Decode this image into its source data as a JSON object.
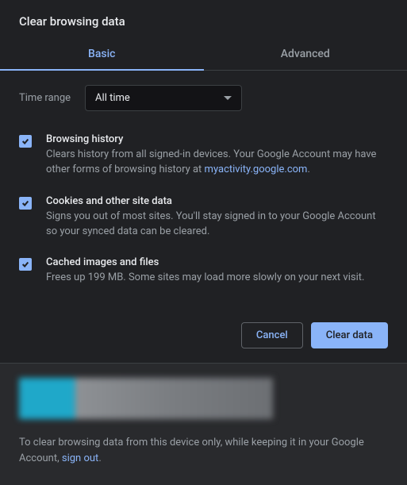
{
  "dialog": {
    "title": "Clear browsing data",
    "tabs": {
      "basic": "Basic",
      "advanced": "Advanced"
    },
    "timeRange": {
      "label": "Time range",
      "value": "All time"
    },
    "options": {
      "browsingHistory": {
        "title": "Browsing history",
        "desc_a": "Clears history from all signed-in devices. Your Google Account may have other forms of browsing history at ",
        "link": "myactivity.google.com",
        "desc_b": "."
      },
      "cookies": {
        "title": "Cookies and other site data",
        "desc": "Signs you out of most sites. You'll stay signed in to your Google Account so your synced data can be cleared."
      },
      "cache": {
        "title": "Cached images and files",
        "desc": "Frees up 199 MB. Some sites may load more slowly on your next visit."
      }
    },
    "buttons": {
      "cancel": "Cancel",
      "clear": "Clear data"
    },
    "footer": {
      "text_a": "To clear browsing data from this device only, while keeping it in your Google Account, ",
      "link": "sign out",
      "text_b": "."
    }
  }
}
